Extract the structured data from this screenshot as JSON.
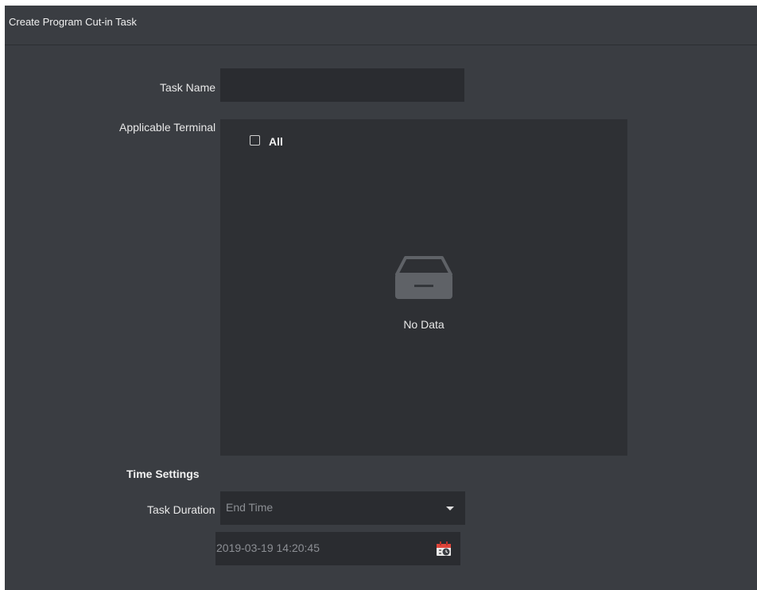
{
  "dialog": {
    "title": "Create Program Cut-in Task"
  },
  "form": {
    "task_name_label": "Task Name",
    "task_name_value": "",
    "applicable_terminal_label": "Applicable Terminal",
    "select_all_label": "All",
    "select_all_checked": false,
    "empty_message": "No Data",
    "time_settings_title": "Time Settings",
    "task_duration_label": "Task Duration",
    "task_duration_selected": "End Time",
    "end_time_value": "2019-03-19 14:20:45"
  },
  "icons": {
    "empty": "empty-tray-icon",
    "dropdown": "chevron-down-icon",
    "calendar": "calendar-icon"
  },
  "colors": {
    "panel_bg": "#3a3d42",
    "field_bg": "#2a2c30",
    "list_bg": "#2e3034",
    "calendar_accent": "#e0453a"
  }
}
